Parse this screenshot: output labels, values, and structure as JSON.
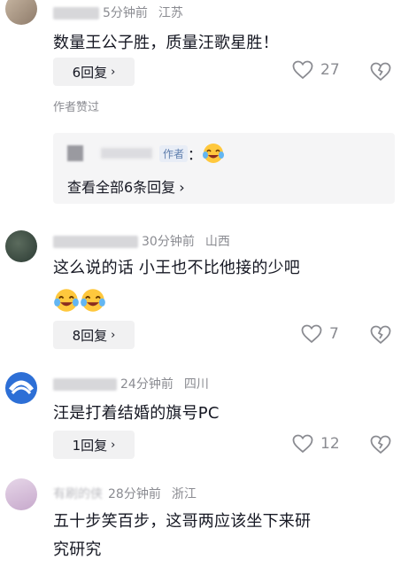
{
  "comments": [
    {
      "user": "句",
      "time": "5分钟前",
      "location": "江苏",
      "text": "数量王公子胜，质量汪歌星胜！",
      "replies": "6回复",
      "likes": "27",
      "author_liked": "作者赞过",
      "sub_reply": {
        "tag": "作者",
        "colon": "：",
        "view_all": "查看全部6条回复"
      }
    },
    {
      "time": "30分钟前",
      "location": "山西",
      "text": "这么说的话 小王也不比他接的少吧",
      "replies": "8回复",
      "likes": "7"
    },
    {
      "time": "24分钟前",
      "location": "四川",
      "text": "汪是打着结婚的旗号PC",
      "replies": "1回复",
      "likes": "12"
    },
    {
      "user": "有刷的侠",
      "time": "28分钟前",
      "location": "浙江",
      "text_line1": "五十步笑百步，这哥两应该坐下来研",
      "text_line2": "究研究"
    }
  ],
  "icons": {
    "chevron": "›",
    "heart": "heart-icon",
    "dislike": "broken-heart-icon"
  }
}
